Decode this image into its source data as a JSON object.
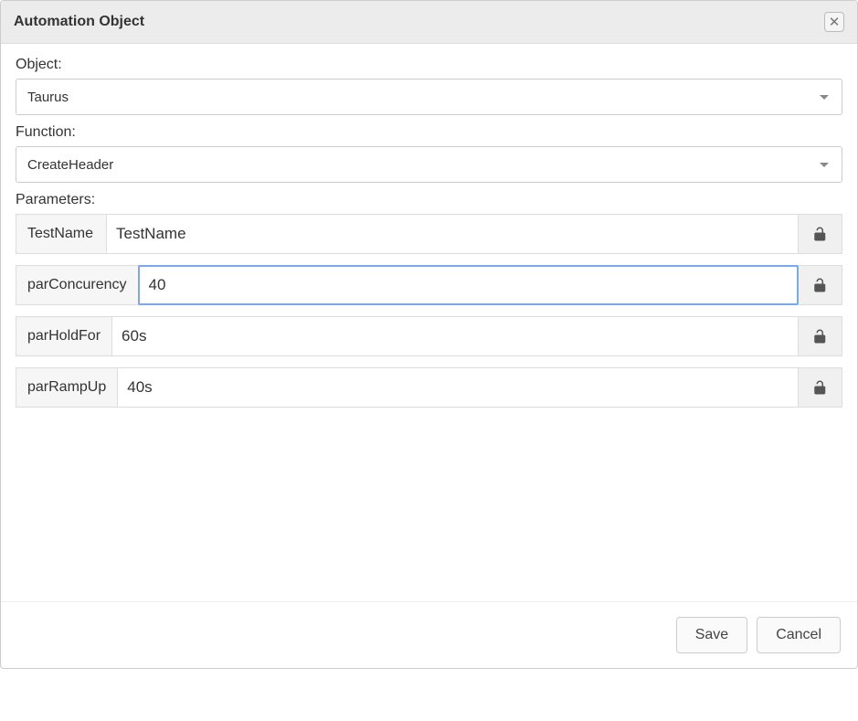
{
  "dialog": {
    "title": "Automation Object",
    "close_symbol": "✕"
  },
  "object_section": {
    "label": "Object:",
    "value": "Taurus"
  },
  "function_section": {
    "label": "Function:",
    "value": "CreateHeader"
  },
  "parameters_section": {
    "label": "Parameters:",
    "rows": [
      {
        "name": "TestName",
        "value": "TestName",
        "focused": false
      },
      {
        "name": "parConcurency",
        "value": "40",
        "focused": true
      },
      {
        "name": "parHoldFor",
        "value": "60s",
        "focused": false
      },
      {
        "name": "parRampUp",
        "value": "40s",
        "focused": false
      }
    ]
  },
  "footer": {
    "save_label": "Save",
    "cancel_label": "Cancel"
  }
}
